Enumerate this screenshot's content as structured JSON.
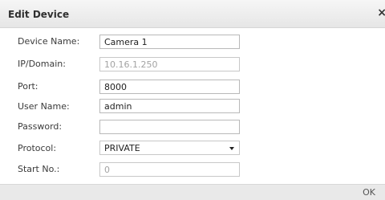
{
  "dialog": {
    "title": "Edit Device",
    "close_glyph": "×"
  },
  "fields": {
    "device_name": {
      "label": "Device Name:",
      "value": "Camera 1"
    },
    "ip_domain": {
      "label": "IP/Domain:",
      "value": "10.16.1.250"
    },
    "port": {
      "label": "Port:",
      "value": "8000"
    },
    "user_name": {
      "label": "User Name:",
      "value": "admin"
    },
    "password": {
      "label": "Password:",
      "value": ""
    },
    "protocol": {
      "label": "Protocol:",
      "value": "PRIVATE"
    },
    "start_no": {
      "label": "Start No.:",
      "value": "0"
    }
  },
  "footer": {
    "ok_label": "OK"
  }
}
